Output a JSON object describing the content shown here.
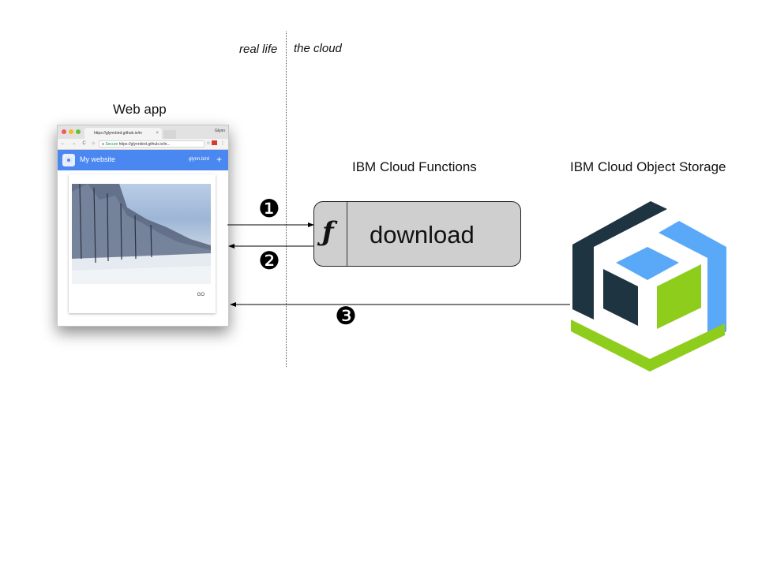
{
  "zones": {
    "left": "real life",
    "right": "the cloud"
  },
  "web_app": {
    "title": "Web app",
    "browser": {
      "tab_title": "https://glynnbird.github.io/in",
      "tab_close": "×",
      "profile": "Glynn",
      "nav": "← → C ⌂",
      "secure": "Secure",
      "url": "https://glynnbird.github.io/in...",
      "site_title": "My website",
      "user": "glynn.bird",
      "add": "+",
      "go": "GO"
    }
  },
  "functions": {
    "title": "IBM Cloud Functions",
    "icon": "ƒ",
    "action": "download"
  },
  "storage": {
    "title": "IBM Cloud Object Storage"
  },
  "steps": [
    "❶",
    "❷",
    "❸"
  ],
  "colors": {
    "storage_dark": "#1f3441",
    "storage_blue": "#5aa9f8",
    "storage_green": "#8fcd1c",
    "appbar_blue": "#4a87f0",
    "function_fill": "#cfcfcf"
  }
}
